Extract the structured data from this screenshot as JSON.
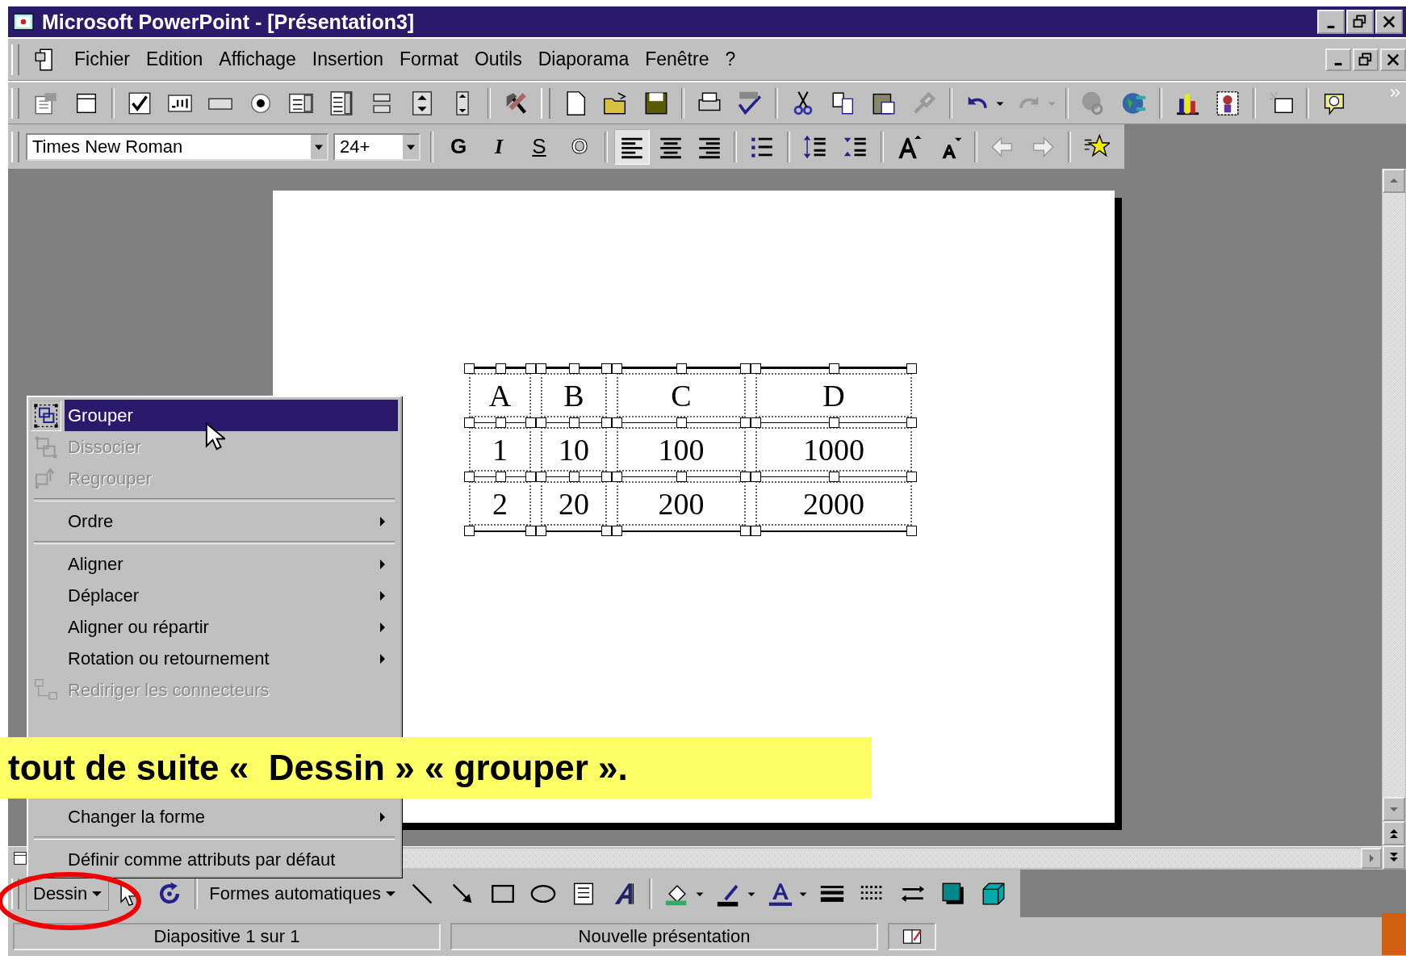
{
  "window": {
    "title": "Microsoft PowerPoint - [Présentation3]"
  },
  "menu_bar": {
    "items": [
      {
        "label": "Fichier"
      },
      {
        "label": "Edition"
      },
      {
        "label": "Affichage"
      },
      {
        "label": "Insertion"
      },
      {
        "label": "Format"
      },
      {
        "label": "Outils"
      },
      {
        "label": "Diaporama"
      },
      {
        "label": "Fenêtre"
      },
      {
        "label": "?"
      }
    ]
  },
  "formatting_toolbar": {
    "font": "Times New Roman",
    "size": "24+",
    "style_buttons": [
      {
        "label": "G",
        "kind": "bold"
      },
      {
        "label": "I",
        "kind": "italic"
      },
      {
        "label": "S",
        "kind": "underline"
      },
      {
        "label": "O",
        "kind": "shadow"
      }
    ],
    "alignment": [
      {
        "kind": "left",
        "selected": true
      },
      {
        "kind": "center",
        "selected": false
      },
      {
        "kind": "right",
        "selected": false
      }
    ]
  },
  "slide": {
    "table": {
      "rows": [
        [
          "A",
          "B",
          "C",
          "D"
        ],
        [
          "1",
          "10",
          "100",
          "1000"
        ],
        [
          "2",
          "20",
          "200",
          "2000"
        ]
      ]
    }
  },
  "context_menu": {
    "items_above": [
      {
        "kind": "group",
        "label": "Grouper",
        "selected": true,
        "disabled": false,
        "submenu": false
      },
      {
        "kind": "ungroup",
        "label": "Dissocier",
        "selected": false,
        "disabled": true,
        "submenu": false
      },
      {
        "kind": "regroup",
        "label": "Regrouper",
        "selected": false,
        "disabled": true,
        "submenu": false
      },
      {
        "kind": "separator"
      },
      {
        "kind": "plain",
        "label": "Ordre",
        "selected": false,
        "disabled": false,
        "submenu": true
      },
      {
        "kind": "separator"
      },
      {
        "kind": "plain",
        "label": "Aligner",
        "selected": false,
        "disabled": false,
        "submenu": true
      },
      {
        "kind": "plain",
        "label": "Déplacer",
        "selected": false,
        "disabled": false,
        "submenu": true
      },
      {
        "kind": "plain",
        "label": "Aligner ou répartir",
        "selected": false,
        "disabled": false,
        "submenu": true
      },
      {
        "kind": "plain",
        "label": "Rotation ou retournement",
        "selected": false,
        "disabled": false,
        "submenu": true
      },
      {
        "kind": "connector",
        "label": "Rediriger les connecteurs",
        "selected": false,
        "disabled": true,
        "submenu": false
      }
    ],
    "items_below": [
      {
        "kind": "plain",
        "label": "Changer la forme",
        "selected": false,
        "disabled": false,
        "submenu": true
      },
      {
        "kind": "separator"
      },
      {
        "kind": "plain",
        "label": "Définir comme attributs par défaut",
        "selected": false,
        "disabled": false,
        "submenu": false
      }
    ]
  },
  "caption": {
    "text": "tout de suite «  Dessin » « grouper »."
  },
  "drawing_toolbar": {
    "draw_menu": "Dessin",
    "autoshapes_menu": "Formes automatiques"
  },
  "status_bar": {
    "slide": "Diapositive 1 sur 1",
    "design": "Nouvelle présentation"
  }
}
